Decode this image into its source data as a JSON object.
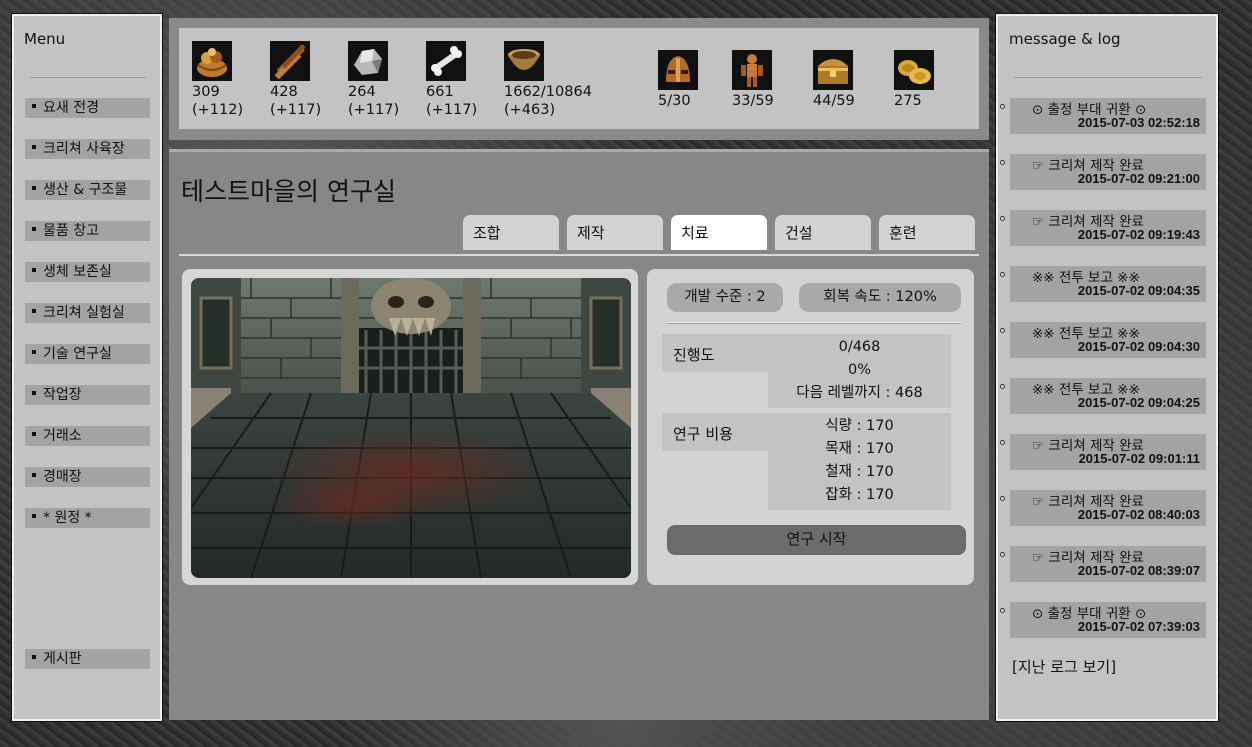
{
  "left_menu": {
    "title": "Menu",
    "items": [
      {
        "label": "요새 전경"
      },
      {
        "label": "크리쳐 사육장"
      },
      {
        "label": "생산 & 구조물"
      },
      {
        "label": "물품 창고"
      },
      {
        "label": "생체 보존실"
      },
      {
        "label": "크리쳐 실험실"
      },
      {
        "label": "기술 연구실"
      },
      {
        "label": "작업장"
      },
      {
        "label": "거래소"
      },
      {
        "label": "경매장"
      },
      {
        "label": "* 원정 *"
      }
    ],
    "board": {
      "label": "게시판"
    }
  },
  "resources": [
    {
      "icon": "food-basket-icon",
      "value": "309",
      "delta": "(+112)"
    },
    {
      "icon": "wood-planks-icon",
      "value": "428",
      "delta": "(+117)"
    },
    {
      "icon": "iron-ore-icon",
      "value": "264",
      "delta": "(+117)"
    },
    {
      "icon": "bone-icon",
      "value": "661",
      "delta": "(+117)"
    },
    {
      "icon": "bowl-icon",
      "value": "1662/10864",
      "delta": "(+463)"
    }
  ],
  "stats": [
    {
      "icon": "helmet-icon",
      "value": "5/30"
    },
    {
      "icon": "creature-figure-icon",
      "value": "33/59"
    },
    {
      "icon": "treasure-chest-icon",
      "value": "44/59"
    },
    {
      "icon": "gold-coins-icon",
      "value": "275"
    }
  ],
  "main": {
    "title": "테스트마을의 연구실",
    "tabs": [
      {
        "label": "조합",
        "active": false
      },
      {
        "label": "제작",
        "active": false
      },
      {
        "label": "치료",
        "active": true
      },
      {
        "label": "건설",
        "active": false
      },
      {
        "label": "훈련",
        "active": false
      }
    ],
    "research": {
      "level_label": "개발 수준 : 2",
      "speed_label": "회복 속도 : 120%",
      "progress_label": "진행도",
      "progress_value": "0/468",
      "progress_percent": "0%",
      "next_level": "다음 레벨까지 : 468",
      "cost_label": "연구 비용",
      "costs": [
        "식량 : 170",
        "목재 : 170",
        "철재 : 170",
        "잡화 : 170"
      ],
      "start_button": "연구 시작"
    }
  },
  "log": {
    "title": "message & log",
    "entries": [
      {
        "text": "⊙ 출정 부대 귀환 ⊙",
        "date": "2015-07-03 02:52:18"
      },
      {
        "text": "☞ 크리쳐 제작 완료",
        "date": "2015-07-02 09:21:00"
      },
      {
        "text": "☞ 크리쳐 제작 완료",
        "date": "2015-07-02 09:19:43"
      },
      {
        "text": "※※ 전투 보고 ※※",
        "date": "2015-07-02 09:04:35"
      },
      {
        "text": "※※ 전투 보고 ※※",
        "date": "2015-07-02 09:04:30"
      },
      {
        "text": "※※ 전투 보고 ※※",
        "date": "2015-07-02 09:04:25"
      },
      {
        "text": "☞ 크리쳐 제작 완료",
        "date": "2015-07-02 09:01:11"
      },
      {
        "text": "☞ 크리쳐 제작 완료",
        "date": "2015-07-02 08:40:03"
      },
      {
        "text": "☞ 크리쳐 제작 완료",
        "date": "2015-07-02 08:39:07"
      },
      {
        "text": "⊙ 출정 부대 귀환 ⊙",
        "date": "2015-07-02 07:39:03"
      }
    ],
    "more": "[지난 로그 보기]"
  }
}
